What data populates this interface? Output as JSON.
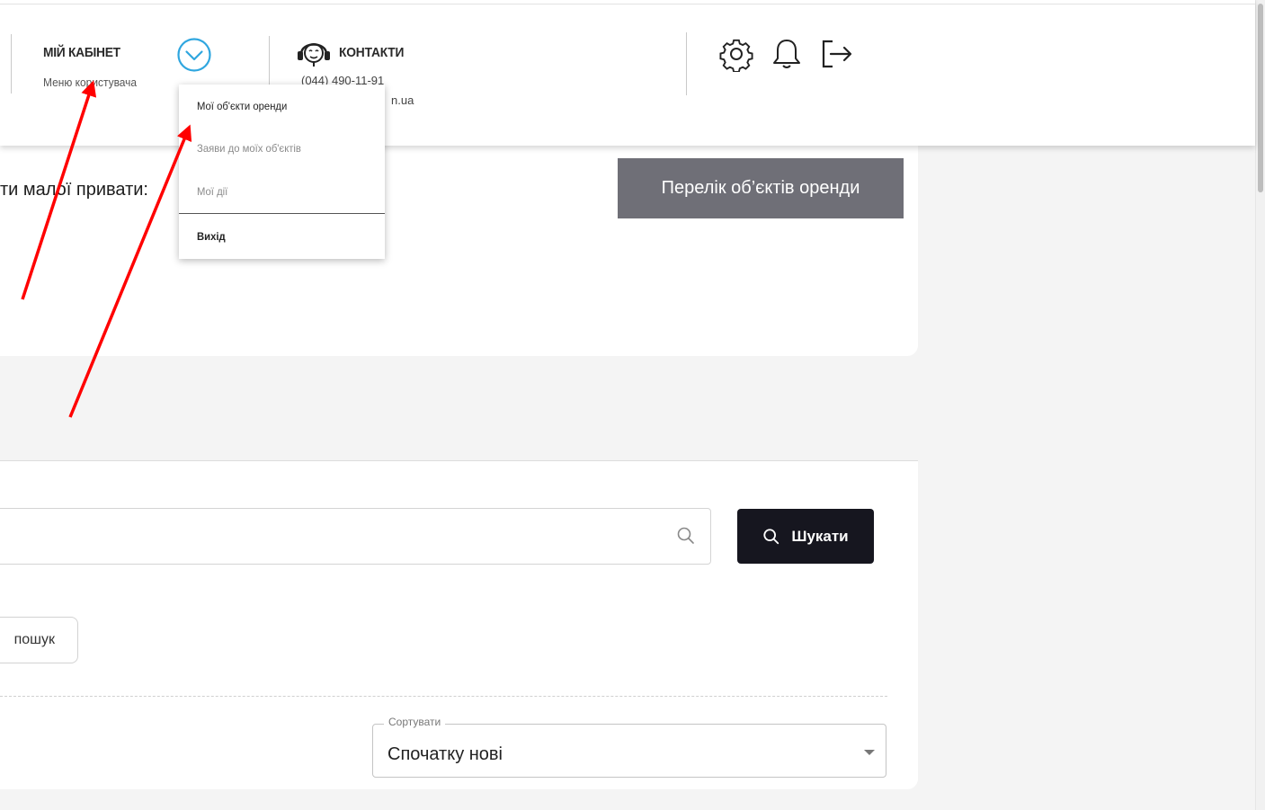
{
  "header": {
    "cabinet_title": "МІЙ КАБІНЕТ",
    "cabinet_subtitle": "Меню користувача",
    "contacts_title": "КОНТАКТИ",
    "contacts_phone": "(044) 490-11-91",
    "contacts_email_fragment": "n.ua"
  },
  "dropdown": {
    "items": [
      {
        "label": "Мої об'єкти оренди",
        "style": "primary"
      },
      {
        "label": "Заяви до моїх об'єктів",
        "style": "muted"
      },
      {
        "label": "Мої дії",
        "style": "muted"
      },
      {
        "label": "Вихід",
        "style": "bold"
      }
    ]
  },
  "main": {
    "intro_text_fragment": "ти малої привати:",
    "list_button_label": "Перелік об’єктів оренди"
  },
  "search": {
    "input_value": "",
    "input_placeholder": "",
    "button_label": "Шукати",
    "advanced_label": "пошук"
  },
  "sort": {
    "label": "Сортувати",
    "selected": "Спочатку нові"
  },
  "colors": {
    "accent_blue": "#2fa6df",
    "annotation_red": "#ff0000",
    "search_button": "#16161f",
    "list_button": "#6f6f77"
  },
  "icons": [
    "chevron-down-circle-icon",
    "headset-icon",
    "gear-icon",
    "bell-icon",
    "logout-icon",
    "search-icon"
  ]
}
